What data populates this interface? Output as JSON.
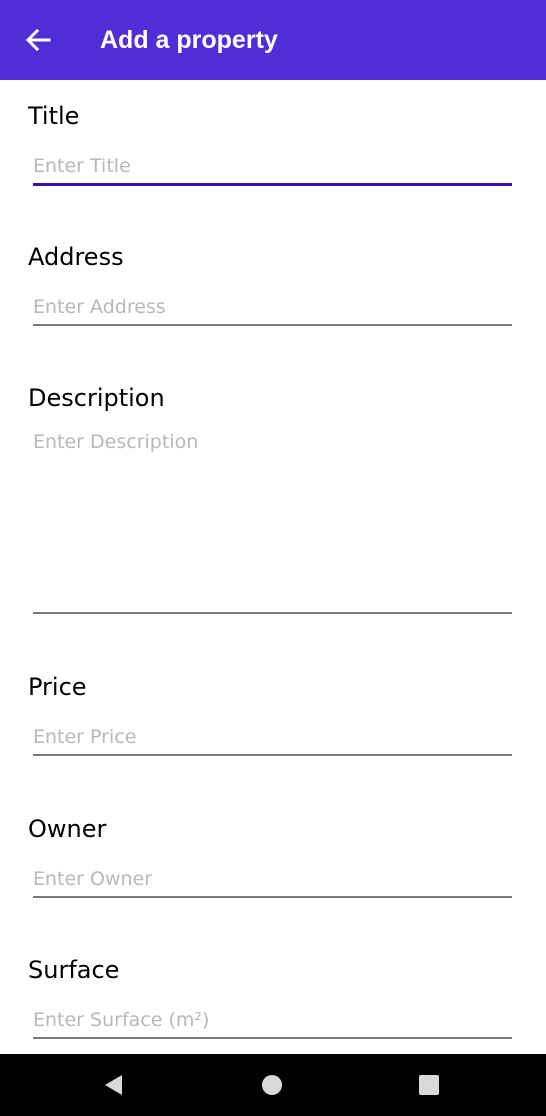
{
  "app_bar": {
    "title": "Add a property",
    "back_icon": "arrow-left-icon",
    "color": "#512DD8"
  },
  "form": {
    "title": {
      "label": "Title",
      "placeholder": "Enter Title",
      "value": ""
    },
    "address": {
      "label": "Address",
      "placeholder": "Enter Address",
      "value": ""
    },
    "description": {
      "label": "Description",
      "placeholder": "Enter Description",
      "value": ""
    },
    "price": {
      "label": "Price",
      "placeholder": "Enter Price",
      "value": ""
    },
    "owner": {
      "label": "Owner",
      "placeholder": "Enter Owner",
      "value": ""
    },
    "surface": {
      "label": "Surface",
      "placeholder": "Enter Surface (m²)",
      "value": ""
    }
  },
  "nav_bar": {
    "back_icon": "triangle-back-icon",
    "home_icon": "circle-home-icon",
    "recents_icon": "square-recents-icon"
  }
}
